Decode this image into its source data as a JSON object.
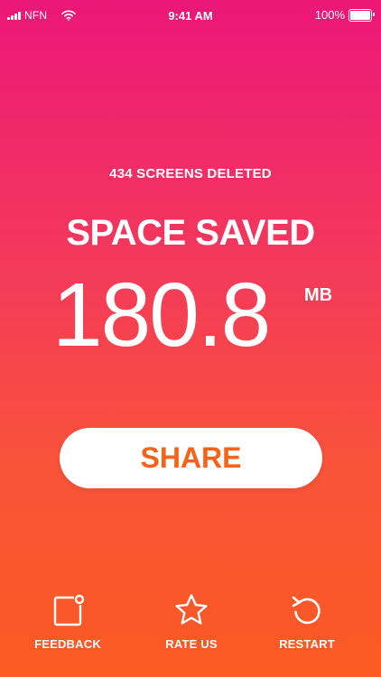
{
  "status_bar": {
    "carrier": "NFN",
    "time": "9:41 AM",
    "battery_percent": "100%",
    "battery_level": 1.0
  },
  "summary": {
    "screens_deleted": "434 SCREENS DELETED",
    "headline": "SPACE SAVED",
    "amount": "180.8",
    "unit": "MB"
  },
  "share_button": {
    "label": "SHARE"
  },
  "bottom_bar": {
    "items": [
      {
        "label": "FEEDBACK",
        "icon": "feedback-icon"
      },
      {
        "label": "RATE US",
        "icon": "star-icon"
      },
      {
        "label": "RESTART",
        "icon": "restart-icon"
      }
    ]
  },
  "colors": {
    "gradient_top": "#ec1779",
    "gradient_bottom": "#fb5a22",
    "share_text": "#f76318",
    "foreground": "#ffffff"
  }
}
